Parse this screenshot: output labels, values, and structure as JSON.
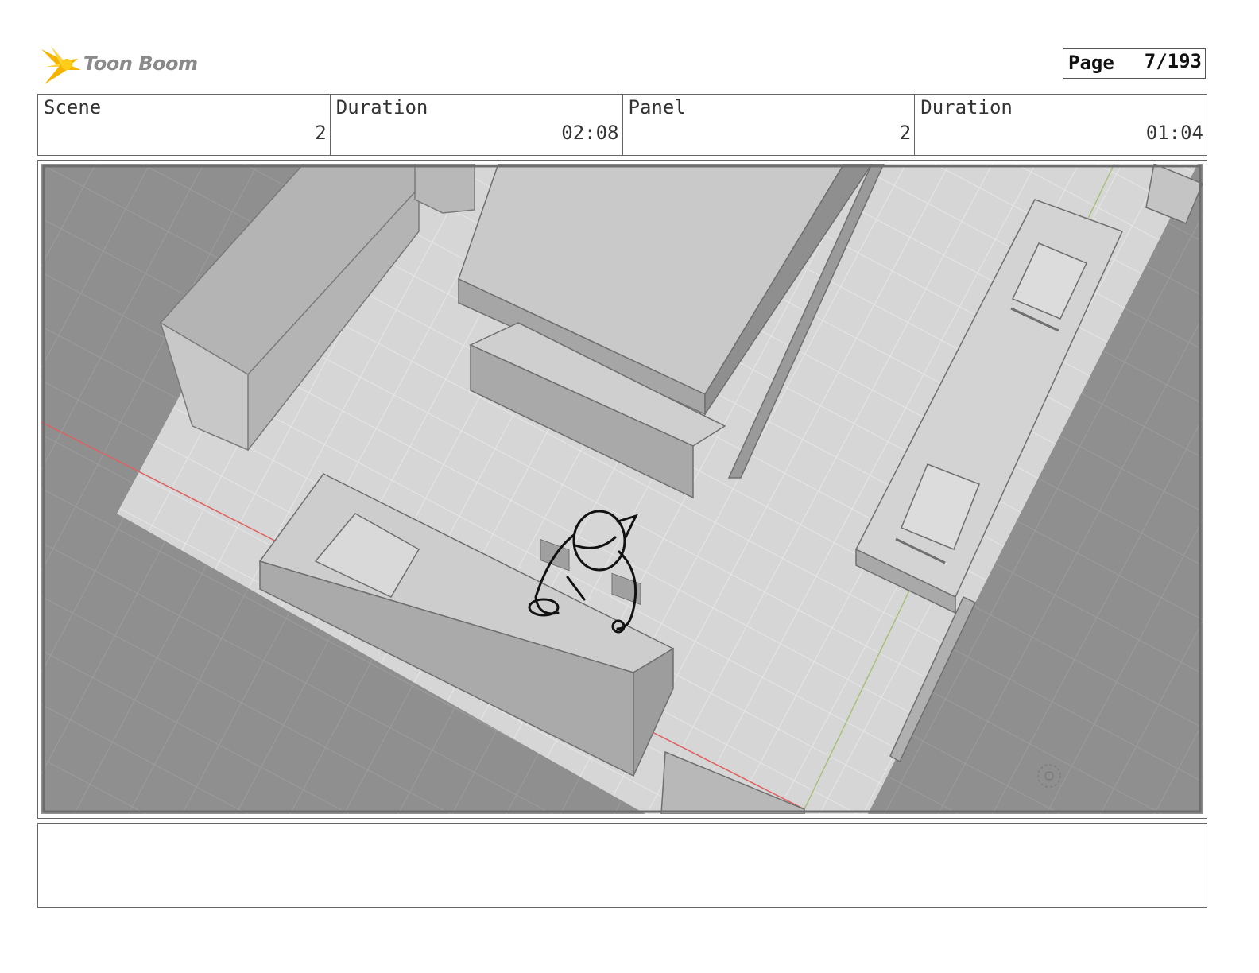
{
  "header": {
    "logo_text": "Toon Boom",
    "page_label": "Page",
    "page_value": "7/193"
  },
  "info": {
    "scene_label": "Scene",
    "scene_value": "2",
    "scene_duration_label": "Duration",
    "scene_duration_value": "02:08",
    "panel_label": "Panel",
    "panel_value": "2",
    "panel_duration_label": "Duration",
    "panel_duration_value": "01:04"
  },
  "panel": {
    "notes": ""
  },
  "colors": {
    "logo_accent": "#f5b400",
    "grid_dark": "#8f8f8f",
    "floor_light": "#d6d6d6",
    "axis_red": "#e06060",
    "axis_green": "#a8c07a"
  }
}
